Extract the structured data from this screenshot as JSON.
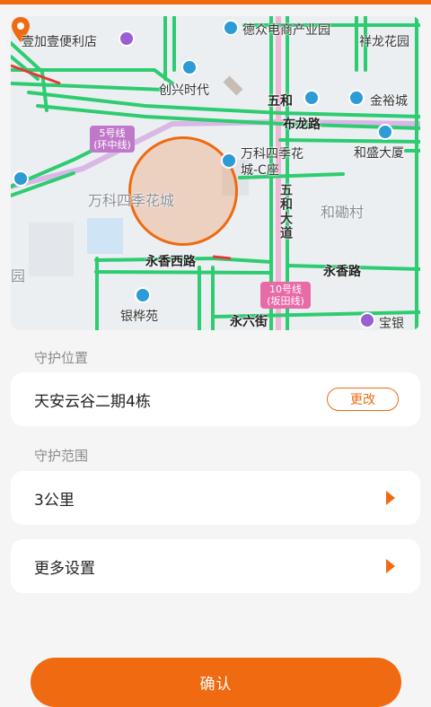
{
  "map": {
    "pois": [
      "壹加壹便利店",
      "德众电商产业园",
      "祥龙花园",
      "创兴时代",
      "五和",
      "金裕城",
      "布龙路",
      "和盛大厦",
      "万科四季花城-C座",
      "万科四季花城",
      "和磡村",
      "五和大道",
      "永香西路",
      "永香路",
      "银桦苑",
      "永六街",
      "宝银",
      "园"
    ],
    "metro": [
      {
        "label": "5号线(环中线)",
        "color": "#c079c9"
      },
      {
        "label": "10号线(坂田线)",
        "color": "#e86aa6"
      }
    ]
  },
  "guard_location": {
    "section_label": "守护位置",
    "address": "天安云谷二期4栋",
    "change_label": "更改"
  },
  "guard_range": {
    "section_label": "守护范围",
    "value": "3公里"
  },
  "more_settings": {
    "label": "更多设置"
  },
  "confirm_label": "确认",
  "colors": {
    "accent": "#ef6a10",
    "road": "#2ecc71",
    "background": "#f5f5f5"
  }
}
